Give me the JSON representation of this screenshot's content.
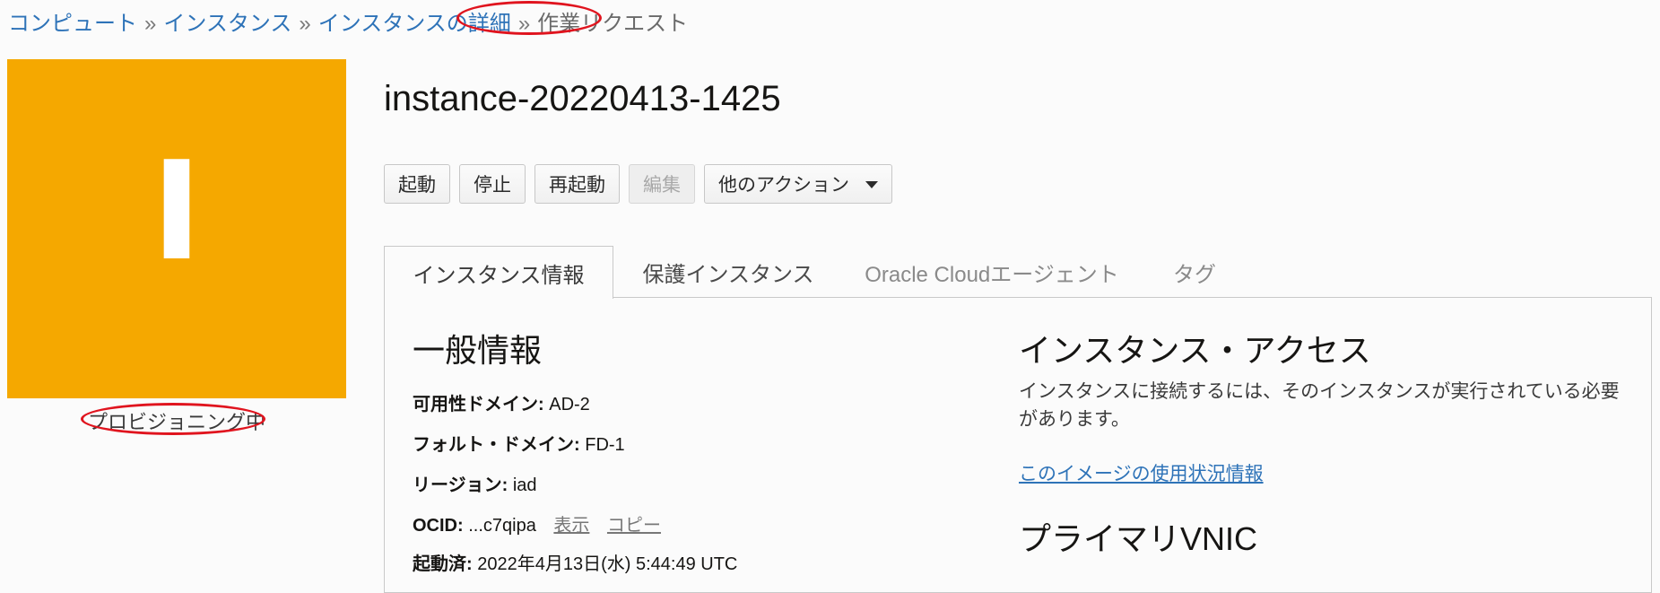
{
  "breadcrumb": {
    "items": [
      "コンピュート",
      "インスタンス",
      "インスタンスの詳細"
    ],
    "separator": "»",
    "current": "作業リクエスト"
  },
  "status": {
    "letter": "I",
    "label": "プロビジョニング中",
    "color": "#f5a800"
  },
  "page_title": "instance-20220413-1425",
  "toolbar": {
    "start": "起動",
    "stop": "停止",
    "reboot": "再起動",
    "edit": "編集",
    "more_actions": "他のアクション"
  },
  "tabs": [
    {
      "label": "インスタンス情報",
      "active": true
    },
    {
      "label": "保護インスタンス",
      "active": false
    },
    {
      "label": "Oracle Cloudエージェント",
      "active": false
    },
    {
      "label": "タグ",
      "active": false
    }
  ],
  "general": {
    "title": "一般情報",
    "availability_domain": {
      "key": "可用性ドメイン:",
      "value": "AD-2"
    },
    "fault_domain": {
      "key": "フォルト・ドメイン:",
      "value": "FD-1"
    },
    "region": {
      "key": "リージョン:",
      "value": "iad"
    },
    "ocid": {
      "key": "OCID:",
      "value": "...c7qipa",
      "show": "表示",
      "copy": "コピー"
    },
    "launched": {
      "key": "起動済:",
      "value": "2022年4月13日(水) 5:44:49 UTC"
    }
  },
  "access": {
    "title": "インスタンス・アクセス",
    "description": "インスタンスに接続するには、そのインスタンスが実行されている必要があります。",
    "usage_link": "このイメージの使用状況情報"
  },
  "vnic": {
    "title": "プライマリVNIC"
  },
  "colors": {
    "link": "#2e73b8",
    "annotation": "#e0141e"
  }
}
